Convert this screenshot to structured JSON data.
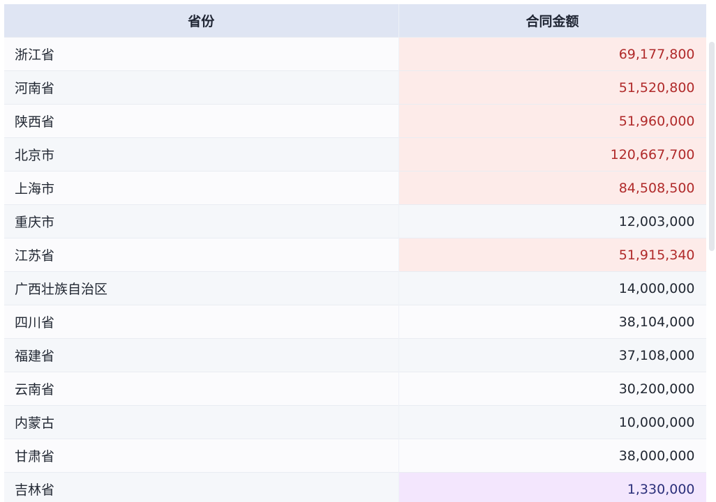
{
  "table": {
    "headers": [
      "省份",
      "合同金额"
    ],
    "rows": [
      {
        "province": "浙江省",
        "amount": "69,177,800",
        "highlight": "red"
      },
      {
        "province": "河南省",
        "amount": "51,520,800",
        "highlight": "red"
      },
      {
        "province": "陕西省",
        "amount": "51,960,000",
        "highlight": "red"
      },
      {
        "province": "北京市",
        "amount": "120,667,700",
        "highlight": "red"
      },
      {
        "province": "上海市",
        "amount": "84,508,500",
        "highlight": "red"
      },
      {
        "province": "重庆市",
        "amount": "12,003,000",
        "highlight": "none"
      },
      {
        "province": "江苏省",
        "amount": "51,915,340",
        "highlight": "red"
      },
      {
        "province": "广西壮族自治区",
        "amount": "14,000,000",
        "highlight": "none"
      },
      {
        "province": "四川省",
        "amount": "38,104,000",
        "highlight": "none"
      },
      {
        "province": "福建省",
        "amount": "37,108,000",
        "highlight": "none"
      },
      {
        "province": "云南省",
        "amount": "30,200,000",
        "highlight": "none"
      },
      {
        "province": "内蒙古",
        "amount": "10,000,000",
        "highlight": "none"
      },
      {
        "province": "甘肃省",
        "amount": "38,000,000",
        "highlight": "none"
      },
      {
        "province": "吉林省",
        "amount": "1,330,000",
        "highlight": "purple"
      }
    ]
  },
  "colors": {
    "header_bg": "#dfe5f3",
    "highlight_red_bg": "#fdebe9",
    "highlight_red_text": "#b02a2a",
    "highlight_purple_bg": "#f3e6fd",
    "highlight_purple_text": "#2b2f7a"
  }
}
